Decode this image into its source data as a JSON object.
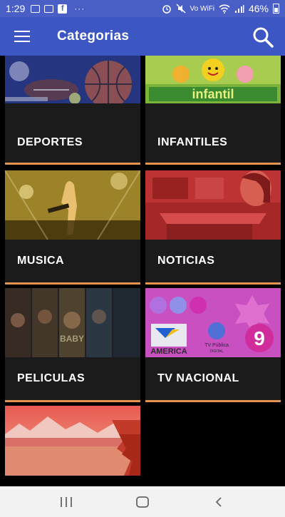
{
  "status_bar": {
    "time": "1:29",
    "more_dots": "···",
    "wifi_label": "Vo WiFi",
    "battery": "46%"
  },
  "app_bar": {
    "title": "Categorias",
    "menu_icon": "hamburger-menu-icon",
    "search_icon": "search-icon"
  },
  "categories": [
    {
      "label": "DEPORTES"
    },
    {
      "label": "INFANTILES"
    },
    {
      "label": "MUSICA"
    },
    {
      "label": "NOTICIAS"
    },
    {
      "label": "PELICULAS"
    },
    {
      "label": "TV NACIONAL"
    },
    {
      "label": ""
    }
  ],
  "thumb_text": {
    "infantil_title": "infantil",
    "tv_america": "AMERICA",
    "tv_publica_line1": "TV Pública",
    "tv_publica_line2": "DIGITAL",
    "tv_nine": "9",
    "movie_baby": "BABY"
  },
  "colors": {
    "accent": "#3c57c4",
    "card_underline": "#e4934e"
  },
  "nav_bar": {
    "recents_icon": "recents-icon",
    "home_icon": "home-icon",
    "back_icon": "back-icon"
  }
}
